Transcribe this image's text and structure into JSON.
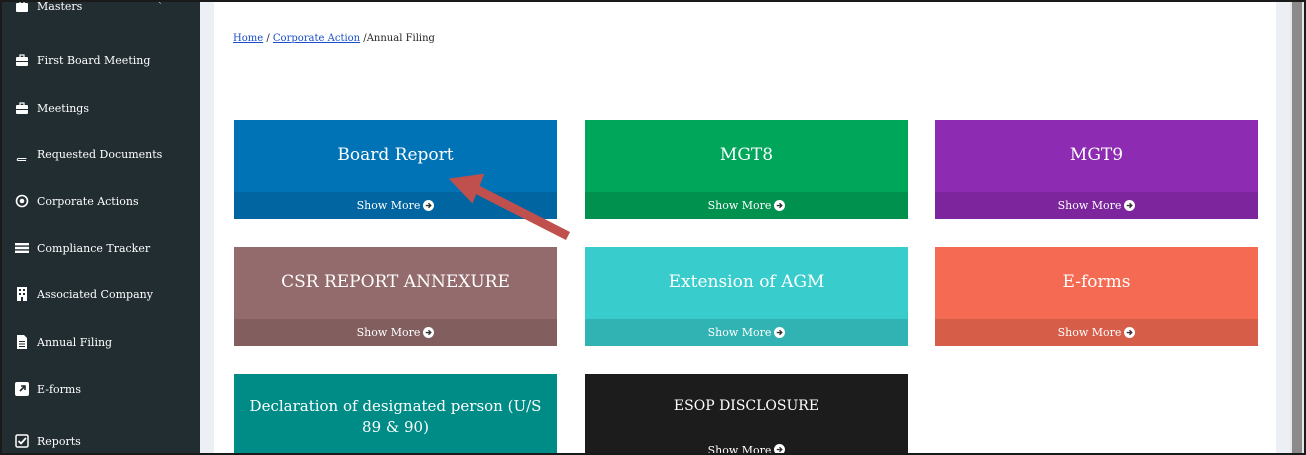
{
  "sidebar": {
    "items": [
      {
        "label": "Masters",
        "icon": "briefcase-icon"
      },
      {
        "label": "First Board Meeting",
        "icon": "briefcase-icon"
      },
      {
        "label": "Meetings",
        "icon": "briefcase-icon"
      },
      {
        "label": "Requested Documents",
        "icon": "book-icon"
      },
      {
        "label": "Corporate Actions",
        "icon": "dot-circle-icon"
      },
      {
        "label": "Compliance Tracker",
        "icon": "list-icon"
      },
      {
        "label": "Associated Company",
        "icon": "building-icon"
      },
      {
        "label": "Annual Filing",
        "icon": "file-icon"
      },
      {
        "label": "E-forms",
        "icon": "external-link-icon"
      },
      {
        "label": "Reports",
        "icon": "check-square-icon"
      }
    ],
    "caret": "‹"
  },
  "breadcrumb": {
    "home": "Home",
    "sep1": " / ",
    "corporate": "Corporate Action",
    "sep2": " /",
    "current": "Annual Filing"
  },
  "cards": [
    {
      "title": "Board Report",
      "more": "Show More",
      "color": "#0073b7"
    },
    {
      "title": "MGT8",
      "more": "Show More",
      "color": "#00a65a"
    },
    {
      "title": "MGT9",
      "more": "Show More",
      "color": "#8e2bb3"
    },
    {
      "title": "CSR REPORT ANNEXURE",
      "more": "Show More",
      "color": "#946b6d"
    },
    {
      "title": "Extension of AGM",
      "more": "Show More",
      "color": "#39cccc"
    },
    {
      "title": "E-forms",
      "more": "Show More",
      "color": "#f46a52"
    },
    {
      "title": "Declaration of designated person (U/S 89 & 90)",
      "more": "Show More",
      "color": "#008c86"
    },
    {
      "title": "ESOP DISCLOSURE",
      "more": "Show More",
      "color": "#1c1c1c"
    }
  ],
  "colors": {
    "sidebar_bg": "#222d32",
    "annotation_arrow": "#c0504d",
    "link": "#1a4ec9"
  }
}
